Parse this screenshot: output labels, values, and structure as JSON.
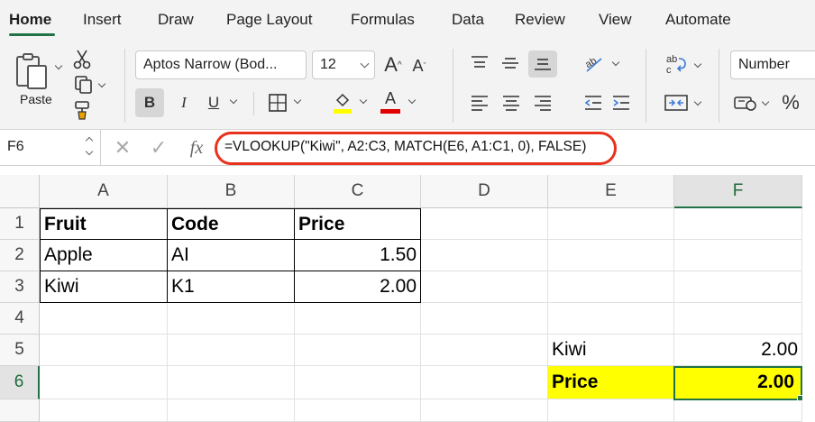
{
  "tabs": [
    "Home",
    "Insert",
    "Draw",
    "Page Layout",
    "Formulas",
    "Data",
    "Review",
    "View",
    "Automate"
  ],
  "ribbon": {
    "paste_label": "Paste",
    "font_name": "Aptos Narrow (Bod...",
    "font_size": "12",
    "bold_label": "B",
    "italic_label": "I",
    "underline_label": "U",
    "number_format": "Number",
    "percent_label": "%",
    "font_color": "#e00000",
    "highlight_color": "#ffff00"
  },
  "formula_bar": {
    "name_box": "F6",
    "fx_label": "fx",
    "formula": "=VLOOKUP(\"Kiwi\", A2:C3, MATCH(E6, A1:C1, 0), FALSE)"
  },
  "sheet": {
    "columns": [
      "A",
      "B",
      "C",
      "D",
      "E",
      "F"
    ],
    "rows": [
      "1",
      "2",
      "3",
      "4",
      "5",
      "6"
    ],
    "cells": {
      "A1": "Fruit",
      "B1": "Code",
      "C1": "Price",
      "A2": "Apple",
      "B2": "AI",
      "C2": "1.50",
      "A3": "Kiwi",
      "B3": "K1",
      "C3": "2.00",
      "E5": "Kiwi",
      "F5": "2.00",
      "E6": "Price",
      "F6": "2.00"
    },
    "selected_cell": "F6",
    "accent_color": "#217346",
    "highlight_fill": "#ffff00"
  }
}
